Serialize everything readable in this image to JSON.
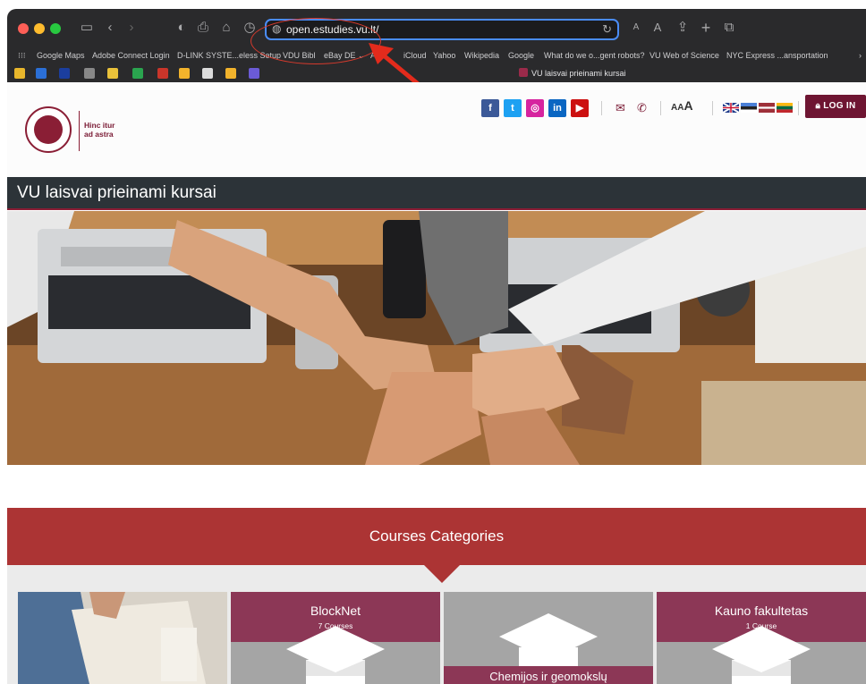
{
  "browser": {
    "url": "open.estudies.vu.lt/",
    "tab_title": "VU laisvai prieinami kursai",
    "reader_small": "A",
    "reader_large": "A",
    "bookmarks": [
      "Google Maps",
      "Adobe Connect Login",
      "D-LINK SYSTE...eless Setup",
      "VDU Bibl",
      "eBay DE ⌄",
      "A",
      "iCloud",
      "Yahoo",
      "Wikipedia",
      "Google",
      "What do we o...gent robots?",
      "VU Web of Science",
      "NYC Express ...ansportation"
    ]
  },
  "site": {
    "logo_motto_line1": "Hinc itur",
    "logo_motto_line2": "ad astra",
    "social": [
      "f",
      "t",
      "ig",
      "in",
      "yt"
    ],
    "font_size_label_small": "AA",
    "font_size_label_large": "A",
    "login_label": "LOG IN",
    "page_title": "VU laisvai prieinami kursai",
    "categories_heading": "Courses Categories",
    "categories": [
      {
        "name": "",
        "count": ""
      },
      {
        "name": "BlockNet",
        "count": "7 Courses"
      },
      {
        "name": "",
        "count": "",
        "label": "Chemijos ir geomokslų"
      },
      {
        "name": "Kauno fakultetas",
        "count": "1 Course"
      }
    ]
  },
  "colors": {
    "brand": "#8a1e35",
    "band": "#ac3434",
    "card_head": "#8c3756",
    "annotation": "#d63a2c",
    "url_focus": "#4a8cf6"
  }
}
